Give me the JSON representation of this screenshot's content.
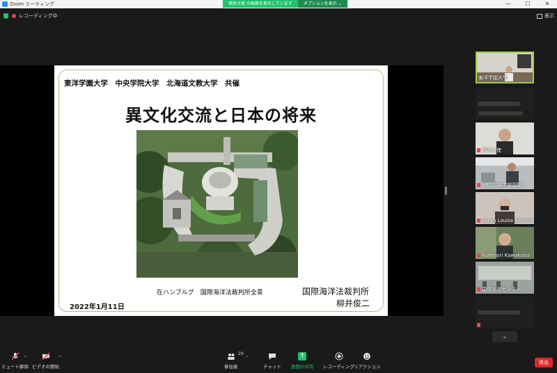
{
  "window": {
    "title": "Zoom ミーティング",
    "controls": [
      "—",
      "☐",
      "✕"
    ]
  },
  "share_banner": {
    "text": "柳井大使 の画面を表示しています",
    "options_label": "オプションを表示 ⌄"
  },
  "topbar": {
    "recording_label": "レコーディング中",
    "view_label": "表示"
  },
  "slide": {
    "hosts": "東洋学園大学　中央学院大学　北海道文教大学　共催",
    "title": "異文化交流と日本の将来",
    "caption": "在ハンブルグ　国際海洋法裁判所全景",
    "organization": "国際海洋法裁判所",
    "presenter": "柳井俊二",
    "date": "2022年1月11日"
  },
  "participants": [
    {
      "name": "東洋学園大学",
      "muted": false,
      "active": true
    },
    {
      "name": "",
      "muted": false,
      "active": false
    },
    {
      "name": "柳井大使",
      "muted": true,
      "active": false
    },
    {
      "name": "HBU国際学部国際...",
      "muted": true,
      "active": false
    },
    {
      "name": "Sarah Louisa Birchley...",
      "muted": true,
      "active": false
    },
    {
      "name": "Fuminori Kawakubo",
      "muted": true,
      "active": false
    },
    {
      "name": "国際交流センター...",
      "muted": true,
      "active": false
    },
    {
      "name": "",
      "muted": true,
      "active": false
    }
  ],
  "toolbar": {
    "unmute_label": "ミュート解除",
    "start_video_label": "ビデオの開始",
    "participants_label": "参加者",
    "participants_count": "29",
    "chat_label": "チャット",
    "share_label": "画面の共有",
    "record_label": "レコーディング",
    "reactions_label": "リアクション",
    "leave_label": "退出"
  },
  "colors": {
    "accent_green": "#23c26b",
    "leave_red": "#e02828",
    "active_speaker_border": "#9ccc3c"
  }
}
